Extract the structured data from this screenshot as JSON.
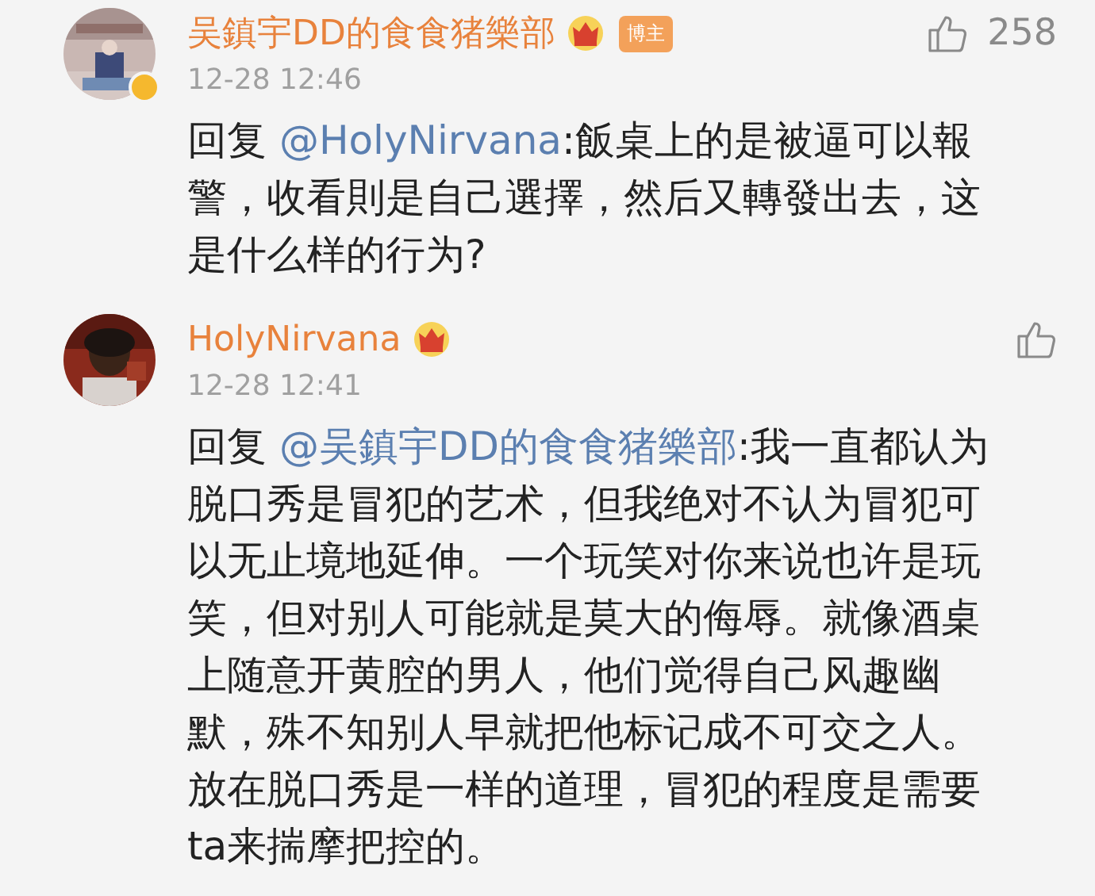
{
  "comments": [
    {
      "author": "吴鎮宇DD的食食猪樂部",
      "verified": true,
      "badge": "博主",
      "time": "12-28 12:46",
      "likes": "258",
      "reply_prefix": "回复",
      "mention": "@HolyNirvana",
      "lines": [
        ":飯桌上的是被逼可以報",
        "警，收看則是自己選擇，然后又轉發出去，这",
        "是什么样的行为?"
      ]
    },
    {
      "author": "HolyNirvana",
      "verified": false,
      "time": "12-28 12:41",
      "reply_prefix": "回复",
      "mention": "@吴鎮宇DD的食食猪樂部",
      "lines": [
        ":我一直都认为",
        "脱口秀是冒犯的艺术，但我绝对不认为冒犯可",
        "以无止境地延伸。一个玩笑对你来说也许是玩",
        "笑，但对别人可能就是莫大的侮辱。就像酒桌",
        "上随意开黄腔的男人，他们觉得自己风趣幽",
        "默，殊不知别人早就把他标记成不可交之人。",
        "放在脱口秀是一样的道理，冒犯的程度是需要",
        "ta来揣摩把控的。"
      ]
    }
  ]
}
